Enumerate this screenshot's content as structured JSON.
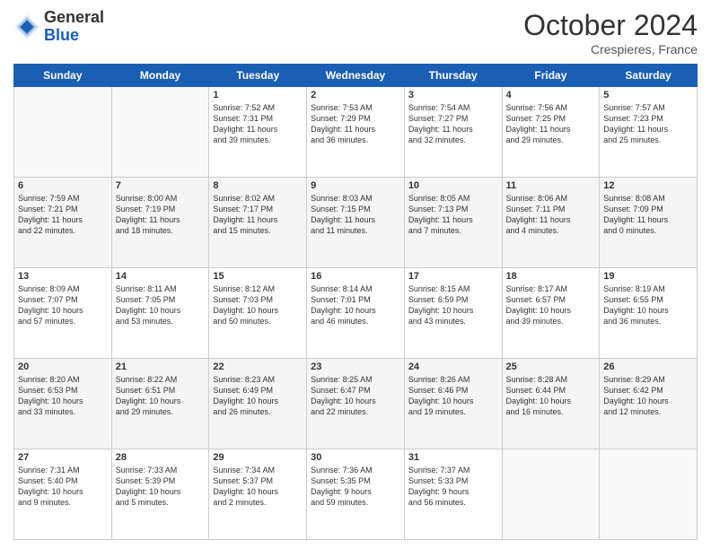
{
  "header": {
    "logo_general": "General",
    "logo_blue": "Blue",
    "month_title": "October 2024",
    "location": "Crespieres, France"
  },
  "days_of_week": [
    "Sunday",
    "Monday",
    "Tuesday",
    "Wednesday",
    "Thursday",
    "Friday",
    "Saturday"
  ],
  "weeks": [
    [
      {
        "day": "",
        "content": ""
      },
      {
        "day": "",
        "content": ""
      },
      {
        "day": "1",
        "content": "Sunrise: 7:52 AM\nSunset: 7:31 PM\nDaylight: 11 hours\nand 39 minutes."
      },
      {
        "day": "2",
        "content": "Sunrise: 7:53 AM\nSunset: 7:29 PM\nDaylight: 11 hours\nand 36 minutes."
      },
      {
        "day": "3",
        "content": "Sunrise: 7:54 AM\nSunset: 7:27 PM\nDaylight: 11 hours\nand 32 minutes."
      },
      {
        "day": "4",
        "content": "Sunrise: 7:56 AM\nSunset: 7:25 PM\nDaylight: 11 hours\nand 29 minutes."
      },
      {
        "day": "5",
        "content": "Sunrise: 7:57 AM\nSunset: 7:23 PM\nDaylight: 11 hours\nand 25 minutes."
      }
    ],
    [
      {
        "day": "6",
        "content": "Sunrise: 7:59 AM\nSunset: 7:21 PM\nDaylight: 11 hours\nand 22 minutes."
      },
      {
        "day": "7",
        "content": "Sunrise: 8:00 AM\nSunset: 7:19 PM\nDaylight: 11 hours\nand 18 minutes."
      },
      {
        "day": "8",
        "content": "Sunrise: 8:02 AM\nSunset: 7:17 PM\nDaylight: 11 hours\nand 15 minutes."
      },
      {
        "day": "9",
        "content": "Sunrise: 8:03 AM\nSunset: 7:15 PM\nDaylight: 11 hours\nand 11 minutes."
      },
      {
        "day": "10",
        "content": "Sunrise: 8:05 AM\nSunset: 7:13 PM\nDaylight: 11 hours\nand 7 minutes."
      },
      {
        "day": "11",
        "content": "Sunrise: 8:06 AM\nSunset: 7:11 PM\nDaylight: 11 hours\nand 4 minutes."
      },
      {
        "day": "12",
        "content": "Sunrise: 8:08 AM\nSunset: 7:09 PM\nDaylight: 11 hours\nand 0 minutes."
      }
    ],
    [
      {
        "day": "13",
        "content": "Sunrise: 8:09 AM\nSunset: 7:07 PM\nDaylight: 10 hours\nand 57 minutes."
      },
      {
        "day": "14",
        "content": "Sunrise: 8:11 AM\nSunset: 7:05 PM\nDaylight: 10 hours\nand 53 minutes."
      },
      {
        "day": "15",
        "content": "Sunrise: 8:12 AM\nSunset: 7:03 PM\nDaylight: 10 hours\nand 50 minutes."
      },
      {
        "day": "16",
        "content": "Sunrise: 8:14 AM\nSunset: 7:01 PM\nDaylight: 10 hours\nand 46 minutes."
      },
      {
        "day": "17",
        "content": "Sunrise: 8:15 AM\nSunset: 6:59 PM\nDaylight: 10 hours\nand 43 minutes."
      },
      {
        "day": "18",
        "content": "Sunrise: 8:17 AM\nSunset: 6:57 PM\nDaylight: 10 hours\nand 39 minutes."
      },
      {
        "day": "19",
        "content": "Sunrise: 8:19 AM\nSunset: 6:55 PM\nDaylight: 10 hours\nand 36 minutes."
      }
    ],
    [
      {
        "day": "20",
        "content": "Sunrise: 8:20 AM\nSunset: 6:53 PM\nDaylight: 10 hours\nand 33 minutes."
      },
      {
        "day": "21",
        "content": "Sunrise: 8:22 AM\nSunset: 6:51 PM\nDaylight: 10 hours\nand 29 minutes."
      },
      {
        "day": "22",
        "content": "Sunrise: 8:23 AM\nSunset: 6:49 PM\nDaylight: 10 hours\nand 26 minutes."
      },
      {
        "day": "23",
        "content": "Sunrise: 8:25 AM\nSunset: 6:47 PM\nDaylight: 10 hours\nand 22 minutes."
      },
      {
        "day": "24",
        "content": "Sunrise: 8:26 AM\nSunset: 6:46 PM\nDaylight: 10 hours\nand 19 minutes."
      },
      {
        "day": "25",
        "content": "Sunrise: 8:28 AM\nSunset: 6:44 PM\nDaylight: 10 hours\nand 16 minutes."
      },
      {
        "day": "26",
        "content": "Sunrise: 8:29 AM\nSunset: 6:42 PM\nDaylight: 10 hours\nand 12 minutes."
      }
    ],
    [
      {
        "day": "27",
        "content": "Sunrise: 7:31 AM\nSunset: 5:40 PM\nDaylight: 10 hours\nand 9 minutes."
      },
      {
        "day": "28",
        "content": "Sunrise: 7:33 AM\nSunset: 5:39 PM\nDaylight: 10 hours\nand 5 minutes."
      },
      {
        "day": "29",
        "content": "Sunrise: 7:34 AM\nSunset: 5:37 PM\nDaylight: 10 hours\nand 2 minutes."
      },
      {
        "day": "30",
        "content": "Sunrise: 7:36 AM\nSunset: 5:35 PM\nDaylight: 9 hours\nand 59 minutes."
      },
      {
        "day": "31",
        "content": "Sunrise: 7:37 AM\nSunset: 5:33 PM\nDaylight: 9 hours\nand 56 minutes."
      },
      {
        "day": "",
        "content": ""
      },
      {
        "day": "",
        "content": ""
      }
    ]
  ]
}
